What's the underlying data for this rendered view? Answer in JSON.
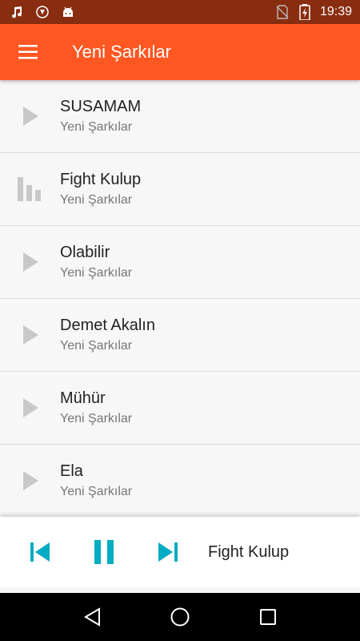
{
  "status_bar": {
    "time": "19:39",
    "icons_left": [
      "music-note-icon",
      "shield-app-icon",
      "android-icon"
    ],
    "icons_right": [
      "no-sim-icon",
      "battery-charging-icon"
    ]
  },
  "app_bar": {
    "title": "Yeni Şarkılar",
    "menu_icon": "hamburger-menu-icon",
    "color": "#ff5722"
  },
  "songs": [
    {
      "title": "SUSAMAM",
      "subtitle": "Yeni Şarkılar",
      "state": "play"
    },
    {
      "title": "Fight Kulup",
      "subtitle": "Yeni Şarkılar",
      "state": "playing"
    },
    {
      "title": "Olabilir",
      "subtitle": "Yeni Şarkılar",
      "state": "play"
    },
    {
      "title": "Demet Akalın",
      "subtitle": "Yeni Şarkılar",
      "state": "play"
    },
    {
      "title": "Mühür",
      "subtitle": "Yeni Şarkılar",
      "state": "play"
    },
    {
      "title": "Ela",
      "subtitle": "Yeni Şarkılar",
      "state": "play"
    }
  ],
  "player": {
    "now_playing": "Fight Kulup",
    "accent": "#00acc1",
    "controls": [
      "skip-previous-icon",
      "pause-icon",
      "skip-next-icon"
    ]
  },
  "nav_bar": {
    "buttons": [
      "back-icon",
      "home-icon",
      "recents-icon"
    ]
  }
}
